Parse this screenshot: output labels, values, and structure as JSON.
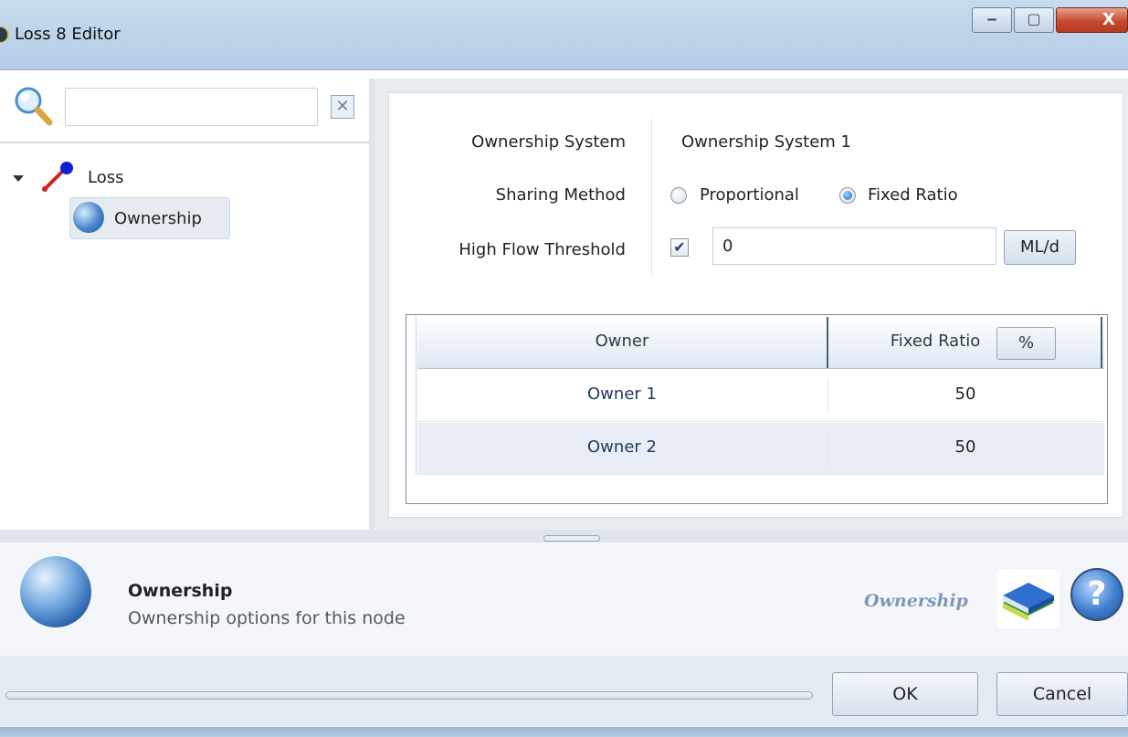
{
  "window": {
    "title": "Loss 8 Editor",
    "controls": {
      "minimize": "‒",
      "maximize": "▢",
      "close": "X"
    }
  },
  "search": {
    "value": "",
    "placeholder": "",
    "clear_glyph": "✕"
  },
  "tree": {
    "root": {
      "label": "Loss",
      "icon": "pipe-node-icon",
      "expanded": true
    },
    "children": [
      {
        "label": "Ownership",
        "icon": "globe-icon",
        "selected": true
      }
    ]
  },
  "form": {
    "ownership_system": {
      "label": "Ownership System",
      "value": "Ownership System 1"
    },
    "sharing_method": {
      "label": "Sharing Method",
      "options": [
        "Proportional",
        "Fixed Ratio"
      ],
      "selected": "Fixed Ratio"
    },
    "high_flow_threshold": {
      "label": "High Flow Threshold",
      "enabled": true,
      "check_glyph": "✔",
      "value": "0",
      "unit": "ML/d"
    }
  },
  "grid": {
    "columns": {
      "owner": "Owner",
      "fixed_ratio": "Fixed Ratio",
      "unit": "%"
    },
    "rows": [
      {
        "owner": "Owner 1",
        "ratio": "50"
      },
      {
        "owner": "Owner 2",
        "ratio": "50"
      }
    ]
  },
  "info": {
    "title": "Ownership",
    "description": "Ownership options for this node",
    "tag": "Ownership",
    "help_glyph": "?"
  },
  "buttons": {
    "ok": "OK",
    "cancel": "Cancel"
  },
  "colors": {
    "titlebar": "#b4cce6",
    "accent": "#1f6fc0",
    "info_tag": "#7f98b8"
  }
}
